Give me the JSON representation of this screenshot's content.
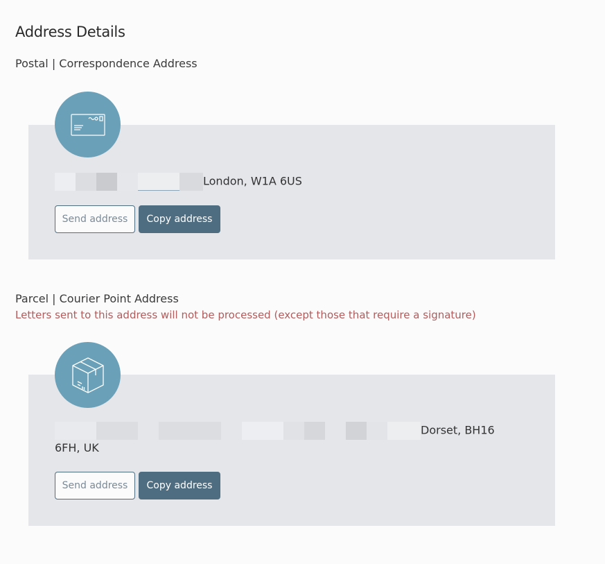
{
  "page": {
    "title": "Address Details"
  },
  "postal": {
    "title": "Postal | Correspondence Address",
    "icon": "envelope-icon",
    "address_visible": "London, W1A 6US",
    "send_label": "Send address",
    "copy_label": "Copy address"
  },
  "parcel": {
    "title": "Parcel | Courier Point Address",
    "warning": "Letters sent to this address will not be processed (except those that require a signature)",
    "icon": "package-box-icon",
    "address_line1_visible": "Dorset, BH16",
    "address_line2": "6FH, UK",
    "send_label": "Send address",
    "copy_label": "Copy address"
  },
  "colors": {
    "accent": "#4f6d80",
    "icon_circle": "#6aa0b8",
    "card_bg": "#e4e6ea",
    "warning_text": "#b35a5a"
  }
}
